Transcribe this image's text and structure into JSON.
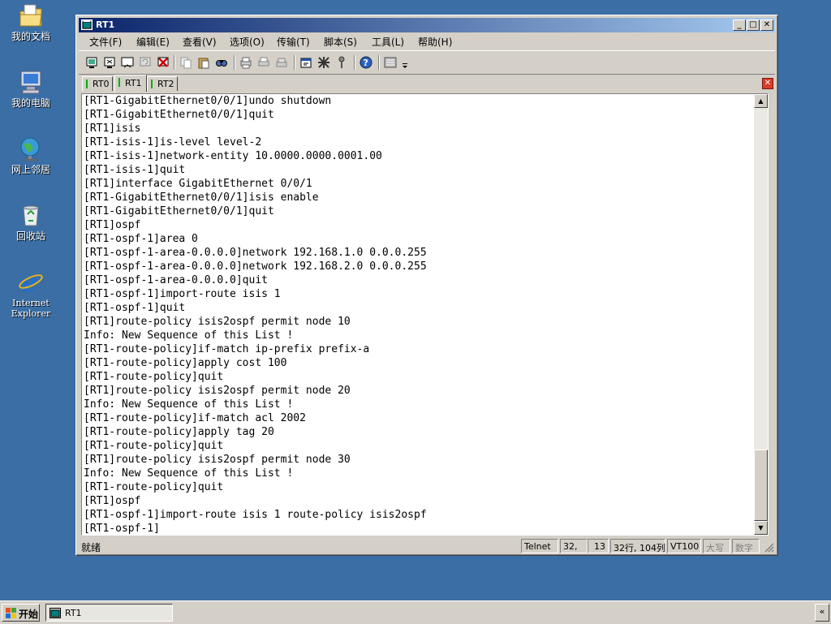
{
  "desktop": {
    "icons": [
      {
        "label": "我的文档"
      },
      {
        "label": "我的电脑"
      },
      {
        "label": "网上邻居"
      },
      {
        "label": "回收站"
      },
      {
        "label_line1": "Internet",
        "label_line2": "Explorer"
      }
    ]
  },
  "window": {
    "title": "RT1",
    "menu": [
      "文件(F)",
      "编辑(E)",
      "查看(V)",
      "选项(O)",
      "传输(T)",
      "脚本(S)",
      "工具(L)",
      "帮助(H)"
    ],
    "tabs": [
      "RT0",
      "RT1",
      "RT2"
    ],
    "active_tab": "RT1",
    "terminal_lines": [
      "[RT1-GigabitEthernet0/0/1]undo shutdown",
      "[RT1-GigabitEthernet0/0/1]quit",
      "[RT1]isis",
      "[RT1-isis-1]is-level level-2",
      "[RT1-isis-1]network-entity 10.0000.0000.0001.00",
      "[RT1-isis-1]quit",
      "[RT1]interface GigabitEthernet 0/0/1",
      "[RT1-GigabitEthernet0/0/1]isis enable",
      "[RT1-GigabitEthernet0/0/1]quit",
      "[RT1]ospf",
      "[RT1-ospf-1]area 0",
      "[RT1-ospf-1-area-0.0.0.0]network 192.168.1.0 0.0.0.255",
      "[RT1-ospf-1-area-0.0.0.0]network 192.168.2.0 0.0.0.255",
      "[RT1-ospf-1-area-0.0.0.0]quit",
      "[RT1-ospf-1]import-route isis 1",
      "[RT1-ospf-1]quit",
      "[RT1]route-policy isis2ospf permit node 10",
      "Info: New Sequence of this List !",
      "[RT1-route-policy]if-match ip-prefix prefix-a",
      "[RT1-route-policy]apply cost 100",
      "[RT1-route-policy]quit",
      "[RT1]route-policy isis2ospf permit node 20",
      "Info: New Sequence of this List !",
      "[RT1-route-policy]if-match acl 2002",
      "[RT1-route-policy]apply tag 20",
      "[RT1-route-policy]quit",
      "[RT1]route-policy isis2ospf permit node 30",
      "Info: New Sequence of this List !",
      "[RT1-route-policy]quit",
      "[RT1]ospf",
      "[RT1-ospf-1]import-route isis 1 route-policy isis2ospf",
      "[RT1-ospf-1]"
    ],
    "status": {
      "ready": "就绪",
      "protocol": "Telnet",
      "cursor_row": "32,",
      "cursor_col": "13",
      "size": "32行, 104列",
      "emulation": "VT100",
      "caps": "大写",
      "num": "数字"
    }
  },
  "taskbar": {
    "start": "开始",
    "task": "RT1",
    "tray_arrow": "«"
  }
}
